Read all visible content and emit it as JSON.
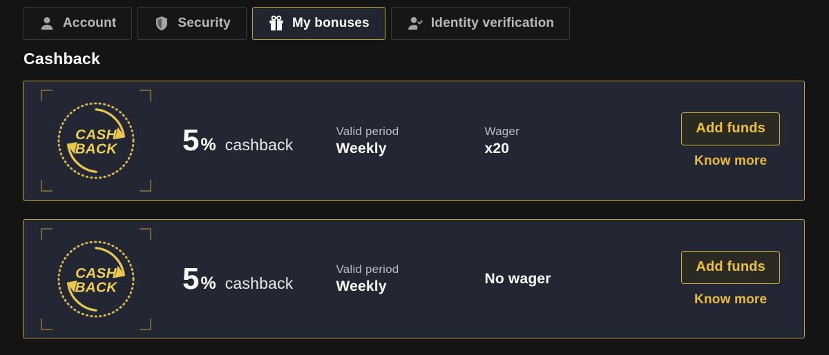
{
  "tabs": [
    {
      "label": "Account",
      "icon": "user-icon",
      "active": false
    },
    {
      "label": "Security",
      "icon": "shield-icon",
      "active": false
    },
    {
      "label": "My bonuses",
      "icon": "gift-icon",
      "active": true
    },
    {
      "label": "Identity verification",
      "icon": "user-check-icon",
      "active": false
    }
  ],
  "section": {
    "title": "Cashback"
  },
  "cards": [
    {
      "logo": {
        "line1": "CASH",
        "line2": "BACK"
      },
      "percent_value": "5",
      "percent_symbol": "%",
      "percent_word": "cashback",
      "valid_period_label": "Valid period",
      "valid_period_value": "Weekly",
      "wager_label": "Wager",
      "wager_value": "x20",
      "add_funds_label": "Add funds",
      "know_more_label": "Know more"
    },
    {
      "logo": {
        "line1": "CASH",
        "line2": "BACK"
      },
      "percent_value": "5",
      "percent_symbol": "%",
      "percent_word": "cashback",
      "valid_period_label": "Valid period",
      "valid_period_value": "Weekly",
      "wager_label": "",
      "wager_value": "No wager",
      "add_funds_label": "Add funds",
      "know_more_label": "Know more"
    }
  ],
  "colors": {
    "page_bg": "#141414",
    "card_bg": "#222733",
    "accent_gold": "#c9a227",
    "button_gold": "#ecc13c",
    "link_gold": "#e7bb38",
    "label_gray": "#b7bdc9",
    "tab_inactive_text": "#b9b9b9",
    "corner_bracket": "#7a6430"
  }
}
